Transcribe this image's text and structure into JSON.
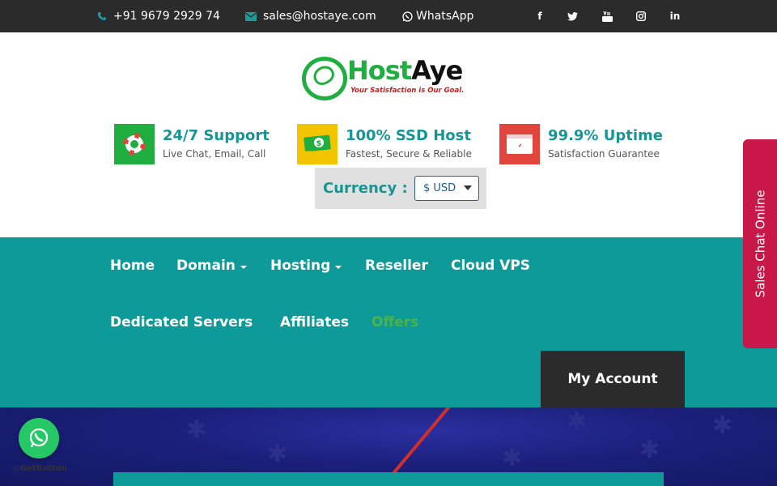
{
  "topbar": {
    "phone": "+91 9679 2929 74",
    "email": "sales@hostaye.com",
    "whatsapp": "WhatsApp",
    "social": [
      "facebook-icon",
      "twitter-icon",
      "youtube-icon",
      "instagram-icon",
      "linkedin-icon"
    ]
  },
  "logo": {
    "brand_host": "Host",
    "brand_aye": "Aye",
    "tagline": "Your Satisfaction is Our Goal."
  },
  "features": [
    {
      "title": "24/7 Support",
      "subtitle": "Live Chat, Email, Call",
      "icon": "lifebuoy-icon",
      "color": "#1fae3f"
    },
    {
      "title": "100% SSD Host",
      "subtitle": "Fastest, Secure & Reliable",
      "icon": "money-icon",
      "color": "#f2c500"
    },
    {
      "title": "99.9% Uptime",
      "subtitle": "Satisfaction Guarantee",
      "icon": "browser-icon",
      "color": "#e2453c"
    }
  ],
  "currency": {
    "label": "Currency :",
    "selected": "$ USD"
  },
  "nav": {
    "home": "Home",
    "domain": "Domain",
    "hosting": "Hosting",
    "reseller": "Reseller",
    "cloud_vps": "Cloud VPS",
    "dedicated": "Dedicated Servers",
    "affiliates": "Affiliates",
    "offers": "Offers",
    "my_account": "My Account"
  },
  "sales_chat": "Sales Chat Online",
  "getbutton": "GetButton",
  "colors": {
    "teal": "#0f9a9a",
    "dark": "#2b2b2b",
    "green": "#1fae3f",
    "offers": "#4cb34c",
    "chat": "#c8184a",
    "whatsapp": "#25c864"
  }
}
